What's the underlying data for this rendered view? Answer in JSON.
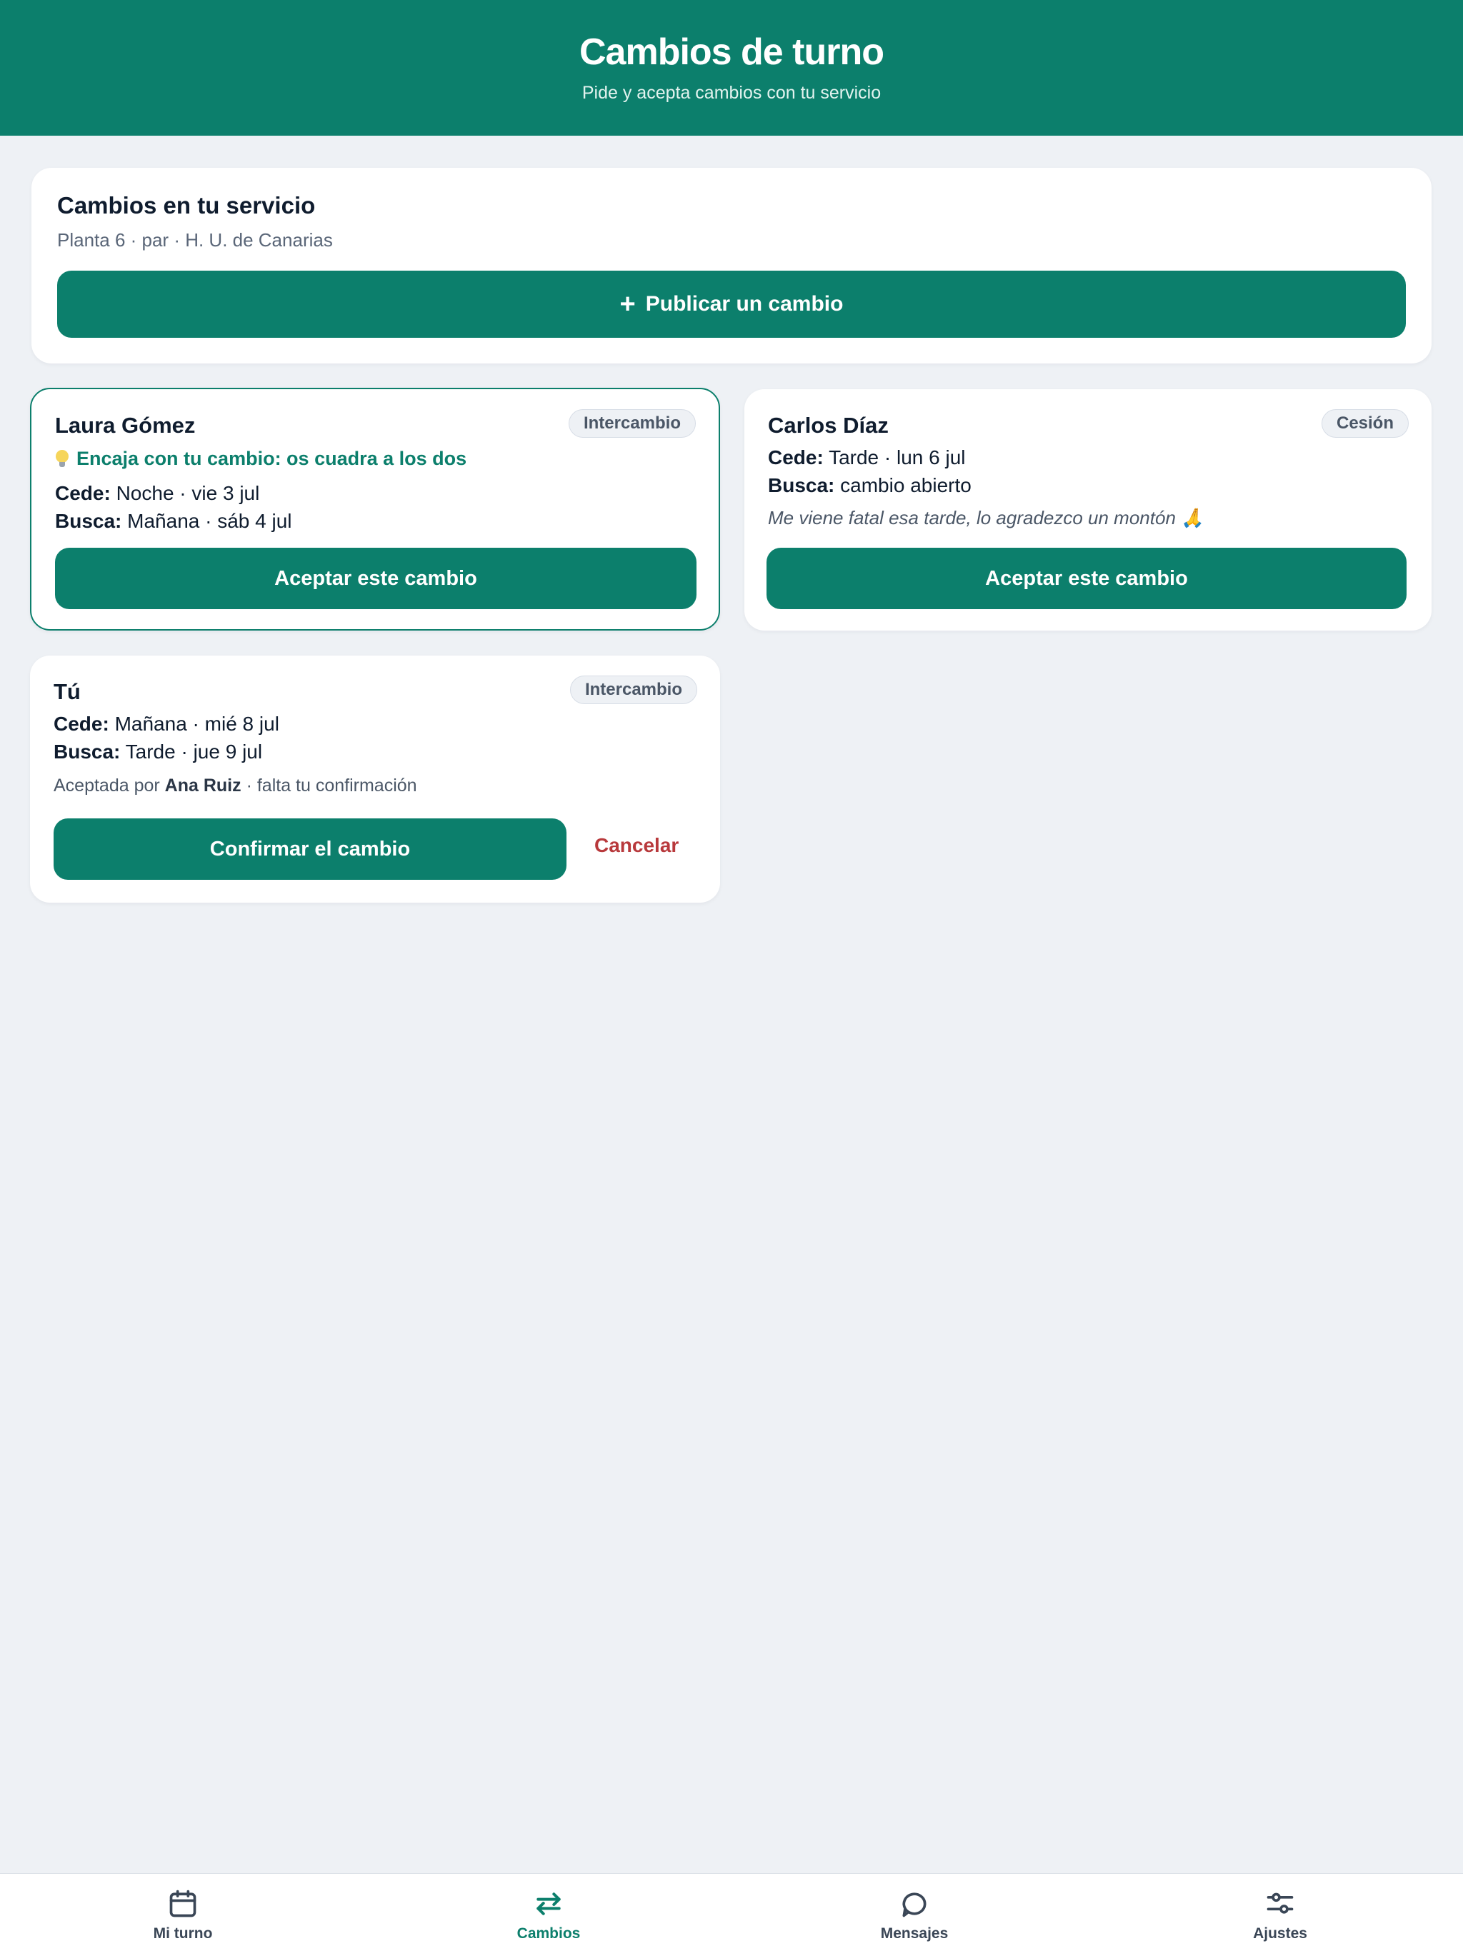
{
  "header": {
    "title": "Cambios de turno",
    "subtitle": "Pide y acepta cambios con tu servicio"
  },
  "service": {
    "title": "Cambios en tu servicio",
    "subtitle": "Planta 6 · par · H. U. de Canarias",
    "publish_label": "Publicar un cambio"
  },
  "offers": [
    {
      "name": "Laura Gómez",
      "badge": "Intercambio",
      "match_text": "Encaja con tu cambio: os cuadra a los dos",
      "cede_label": "Cede:",
      "cede_value": "Noche · vie 3 jul",
      "busca_label": "Busca:",
      "busca_value": "Mañana · sáb 4 jul",
      "accept_label": "Aceptar este cambio"
    },
    {
      "name": "Carlos Díaz",
      "badge": "Cesión",
      "cede_label": "Cede:",
      "cede_value": "Tarde · lun 6 jul",
      "busca_label": "Busca:",
      "busca_value": "cambio abierto",
      "note": "Me viene fatal esa tarde, lo agradezco un montón 🙏",
      "accept_label": "Aceptar este cambio"
    }
  ],
  "mine": {
    "name": "Tú",
    "badge": "Intercambio",
    "cede_label": "Cede:",
    "cede_value": "Mañana · mié 8 jul",
    "busca_label": "Busca:",
    "busca_value": "Tarde · jue 9 jul",
    "status_prefix": "Aceptada por",
    "status_person": "Ana Ruiz",
    "status_suffix": "· falta tu confirmación",
    "confirm_label": "Confirmar el cambio",
    "cancel_label": "Cancelar"
  },
  "tabs": [
    {
      "label": "Mi turno",
      "icon": "calendar-icon"
    },
    {
      "label": "Cambios",
      "icon": "swap-arrows-icon",
      "active": true
    },
    {
      "label": "Mensajes",
      "icon": "chat-bubble-icon"
    },
    {
      "label": "Ajustes",
      "icon": "sliders-icon"
    }
  ],
  "colors": {
    "primary": "#0c7f6c",
    "background": "#eef1f5",
    "danger": "#b8393c"
  }
}
